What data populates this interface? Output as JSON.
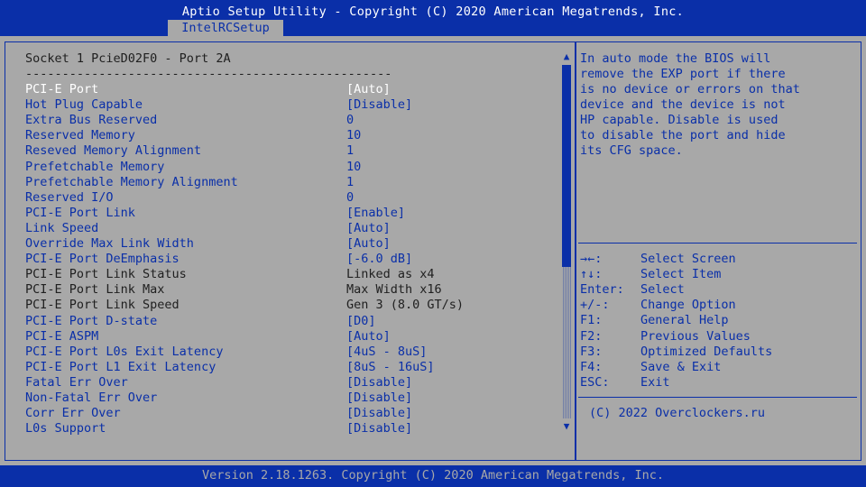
{
  "header": {
    "title": "Aptio Setup Utility - Copyright (C) 2020 American Megatrends, Inc.",
    "tab": "IntelRCSetup"
  },
  "main": {
    "heading": "Socket 1 PcieD02F0 - Port 2A",
    "separator": "--------------------------------------------------",
    "items": [
      {
        "label": "PCI-E Port",
        "value": "[Auto]",
        "state": "selected"
      },
      {
        "label": "Hot Plug Capable",
        "value": "[Disable]",
        "state": "editable"
      },
      {
        "label": "Extra Bus Reserved",
        "value": "0",
        "state": "editable"
      },
      {
        "label": "Reserved Memory",
        "value": "10",
        "state": "editable"
      },
      {
        "label": "Reseved Memory Alignment",
        "value": "1",
        "state": "editable"
      },
      {
        "label": "Prefetchable Memory",
        "value": "10",
        "state": "editable"
      },
      {
        "label": "Prefetchable Memory Alignment",
        "value": "1",
        "state": "editable"
      },
      {
        "label": "Reserved I/O",
        "value": "0",
        "state": "editable"
      },
      {
        "label": "PCI-E Port Link",
        "value": "[Enable]",
        "state": "editable"
      },
      {
        "label": "Link Speed",
        "value": "[Auto]",
        "state": "editable"
      },
      {
        "label": "Override Max Link Width",
        "value": "[Auto]",
        "state": "editable"
      },
      {
        "label": "PCI-E Port DeEmphasis",
        "value": "[-6.0 dB]",
        "state": "editable"
      },
      {
        "label": "PCI-E Port Link Status",
        "value": "Linked as x4",
        "state": "static"
      },
      {
        "label": "PCI-E Port Link Max",
        "value": "Max Width x16",
        "state": "static"
      },
      {
        "label": "PCI-E Port Link Speed",
        "value": "Gen 3 (8.0 GT/s)",
        "state": "static"
      },
      {
        "label": "PCI-E Port D-state",
        "value": "[D0]",
        "state": "editable"
      },
      {
        "label": "PCI-E ASPM",
        "value": "[Auto]",
        "state": "editable"
      },
      {
        "label": "PCI-E Port L0s Exit Latency",
        "value": "[4uS - 8uS]",
        "state": "editable"
      },
      {
        "label": "PCI-E Port L1 Exit Latency",
        "value": "[8uS - 16uS]",
        "state": "editable"
      },
      {
        "label": "Fatal Err Over",
        "value": "[Disable]",
        "state": "editable"
      },
      {
        "label": "Non-Fatal Err Over",
        "value": "[Disable]",
        "state": "editable"
      },
      {
        "label": "Corr Err Over",
        "value": "[Disable]",
        "state": "editable"
      },
      {
        "label": "L0s Support",
        "value": "[Disable]",
        "state": "editable"
      }
    ],
    "scrollbar": {
      "up_glyph": "▲",
      "down_glyph": "▼"
    }
  },
  "help": {
    "lines": [
      "In auto mode the BIOS will",
      "remove the EXP port if there",
      "is no device or errors on that",
      "device and the device is not",
      "HP capable. Disable is used",
      "to disable the port and hide",
      "its CFG space."
    ]
  },
  "keys": [
    {
      "key": "→←:",
      "desc": "Select Screen"
    },
    {
      "key": "↑↓:",
      "desc": "Select Item"
    },
    {
      "key": "Enter:",
      "desc": "Select"
    },
    {
      "key": "+/-:",
      "desc": "Change Option"
    },
    {
      "key": "F1:",
      "desc": "General Help"
    },
    {
      "key": "F2:",
      "desc": "Previous Values"
    },
    {
      "key": "F3:",
      "desc": "Optimized Defaults"
    },
    {
      "key": "F4:",
      "desc": "Save & Exit"
    },
    {
      "key": "ESC:",
      "desc": "Exit"
    }
  ],
  "right_copyright": "(C) 2022 Overclockers.ru",
  "footer": "Version 2.18.1263. Copyright (C) 2020 American Megatrends, Inc.",
  "colors": {
    "background": "#a8a8a8",
    "accent": "#0a2fa8",
    "selected_text": "#ffffff",
    "static_text": "#202020"
  }
}
